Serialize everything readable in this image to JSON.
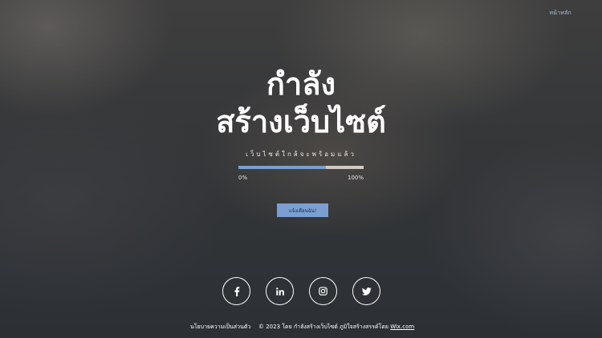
{
  "nav": {
    "home_label": "หน้าหลัก"
  },
  "hero": {
    "title_line1": "กำลัง",
    "title_line2": "สร้างเว็บไซต์",
    "subtitle": "เว็บไซต์ใกล้จะพร้อมแล้ว"
  },
  "progress": {
    "value_percent": 70,
    "min_label": "0%",
    "max_label": "100%"
  },
  "notify_button": {
    "label": "แจ้งเตือนฉัน!"
  },
  "social": {
    "items": [
      {
        "name": "facebook",
        "icon": "facebook-icon"
      },
      {
        "name": "linkedin",
        "icon": "linkedin-icon"
      },
      {
        "name": "instagram",
        "icon": "instagram-icon"
      },
      {
        "name": "twitter",
        "icon": "twitter-icon"
      }
    ]
  },
  "footer": {
    "privacy_label": "นโยบายความเป็นส่วนตัว",
    "copyright_text": "© 2023 โดย กำลังสร้างเว็บไซต์ ภูมิใจสร้างสรรค์โดย ",
    "wix_label": "Wix.com"
  },
  "colors": {
    "accent": "#7a9fd0",
    "progress_track": "#cfcac4",
    "home_link": "#aac4ea"
  }
}
